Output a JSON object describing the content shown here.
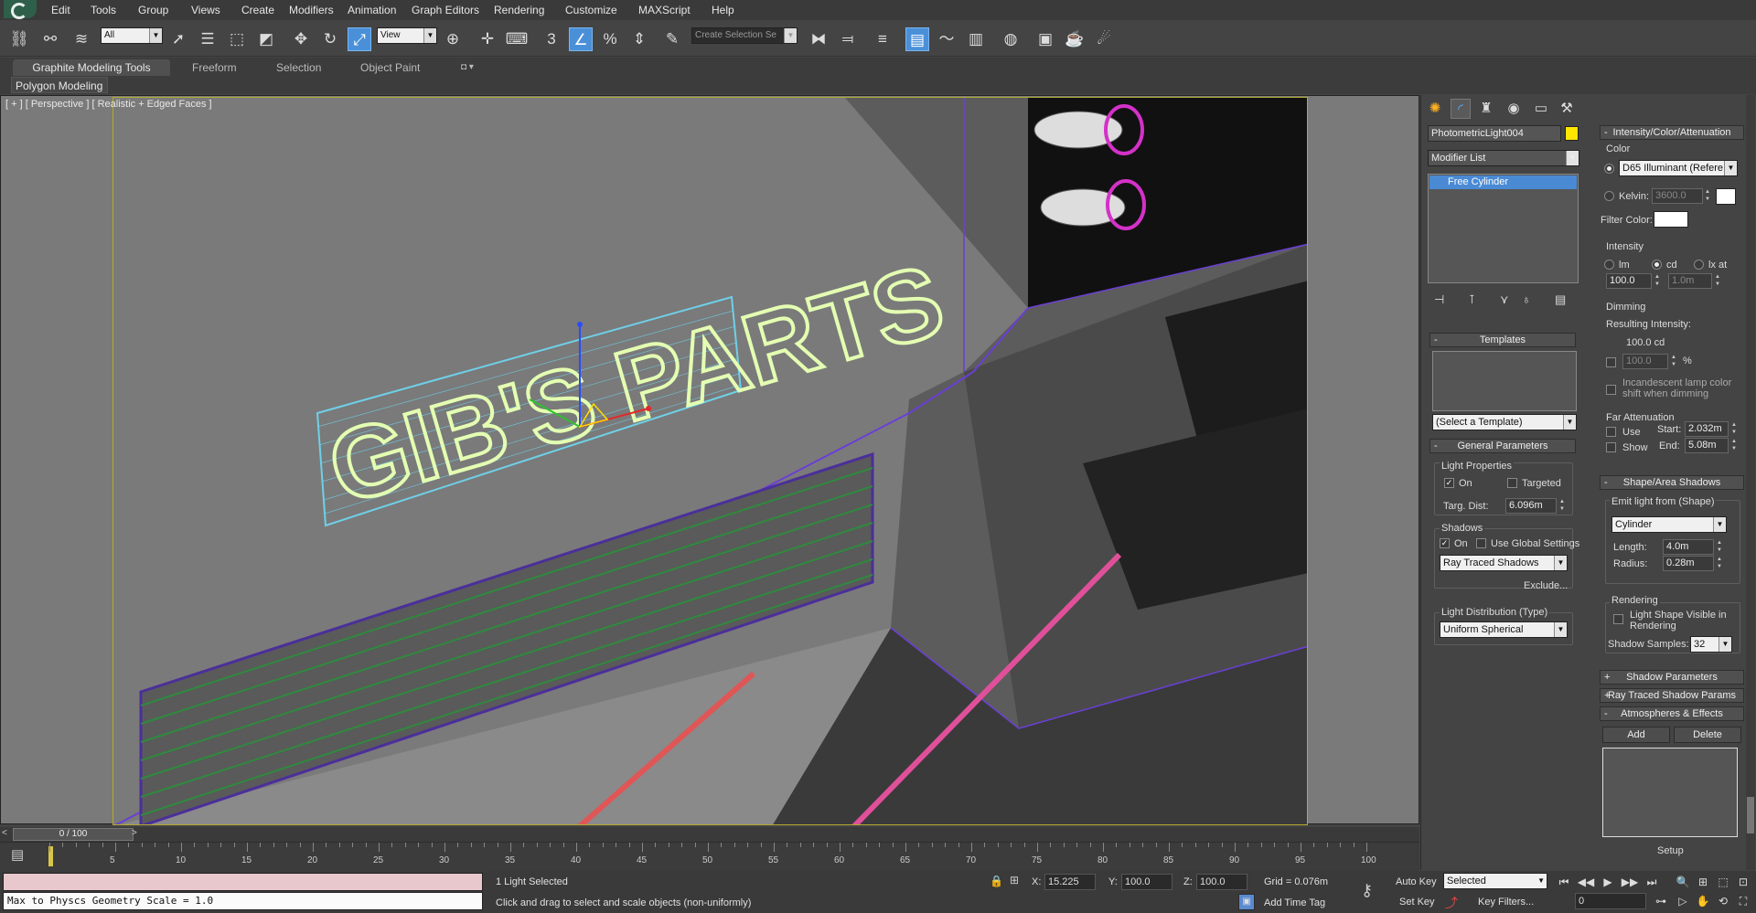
{
  "menubar": {
    "items": [
      "Edit",
      "Tools",
      "Group",
      "Views",
      "Create",
      "Modifiers",
      "Animation",
      "Graph Editors",
      "Rendering",
      "Customize",
      "MAXScript",
      "Help"
    ]
  },
  "toolbar": {
    "selection_filter": "All",
    "reference_coord": "View",
    "named_selection_placeholder": "Create Selection Se",
    "snap_label": "3"
  },
  "ribbon": {
    "tabs": [
      "Graphite Modeling Tools",
      "Freeform",
      "Selection",
      "Object Paint"
    ],
    "panel": "Polygon Modeling"
  },
  "viewport": {
    "label": "[ + ] [ Perspective ] [ Realistic + Edged Faces ]",
    "sign_text": "GIB'S PARTS"
  },
  "timeline": {
    "frame_display": "0 / 100",
    "ticks": [
      "5",
      "10",
      "15",
      "20",
      "25",
      "30",
      "35",
      "40",
      "45",
      "50",
      "55",
      "60",
      "65",
      "70",
      "75",
      "80",
      "85",
      "90",
      "95",
      "100"
    ]
  },
  "status": {
    "maxscript_output": "Max to Physcs Geometry Scale = 1.0",
    "selection_info": "1 Light Selected",
    "prompt": "Click and drag to select and scale objects (non-uniformly)",
    "x_label": "X:",
    "x_value": "15.225",
    "y_label": "Y:",
    "y_value": "100.0",
    "z_label": "Z:",
    "z_value": "100.0",
    "grid": "Grid = 0.076m",
    "add_time_tag": "Add Time Tag",
    "auto_key": "Auto Key",
    "set_key": "Set Key",
    "key_mode": "Selected",
    "key_filters": "Key Filters...",
    "current_frame": "0"
  },
  "command_panel": {
    "object_name": "PhotometricLight004",
    "object_color": "#ffe600",
    "modifier_list": "Modifier List",
    "stack_item": "Free Cylinder",
    "templates": {
      "header": "Templates",
      "select": "(Select a Template)"
    },
    "general": {
      "header": "General Parameters",
      "light_properties": "Light Properties",
      "on": "On",
      "targeted": "Targeted",
      "targ_dist_label": "Targ. Dist:",
      "targ_dist": "6.096m",
      "shadows": "Shadows",
      "shadows_on": "On",
      "use_global": "Use Global Settings",
      "shadow_type": "Ray Traced Shadows",
      "exclude": "Exclude...",
      "distribution_label": "Light Distribution (Type)",
      "distribution": "Uniform Spherical"
    },
    "intensity": {
      "header": "Intensity/Color/Attenuation",
      "color_label": "Color",
      "color_preset": "D65 Illuminant (Refere",
      "kelvin_label": "Kelvin:",
      "kelvin": "3600.0",
      "filter_color_label": "Filter Color:",
      "intensity_label": "Intensity",
      "lm": "lm",
      "cd": "cd",
      "lx_at": "lx at",
      "intensity_value": "100.0",
      "lx_dist": "1.0m",
      "dimming_label": "Dimming",
      "resulting_label": "Resulting Intensity:",
      "resulting_value": "100.0 cd",
      "dim_percent": "100.0",
      "percent_sign": "%",
      "incandescent": "Incandescent lamp color shift when dimming",
      "far_atten_label": "Far Attenuation",
      "use": "Use",
      "show": "Show",
      "start_label": "Start:",
      "start_value": "2.032m",
      "end_label": "End:",
      "end_value": "5.08m"
    },
    "shape": {
      "header": "Shape/Area Shadows",
      "emit_label": "Emit light from (Shape)",
      "shape_type": "Cylinder",
      "length_label": "Length:",
      "length_value": "4.0m",
      "radius_label": "Radius:",
      "radius_value": "0.28m",
      "rendering_label": "Rendering",
      "visible_label": "Light Shape Visible in Rendering",
      "samples_label": "Shadow Samples:",
      "samples_value": "32"
    },
    "shadow_params_header": "Shadow Parameters",
    "raytrace_header": "Ray Traced Shadow Params",
    "atmos": {
      "header": "Atmospheres & Effects",
      "add": "Add",
      "delete": "Delete",
      "setup": "Setup"
    }
  }
}
